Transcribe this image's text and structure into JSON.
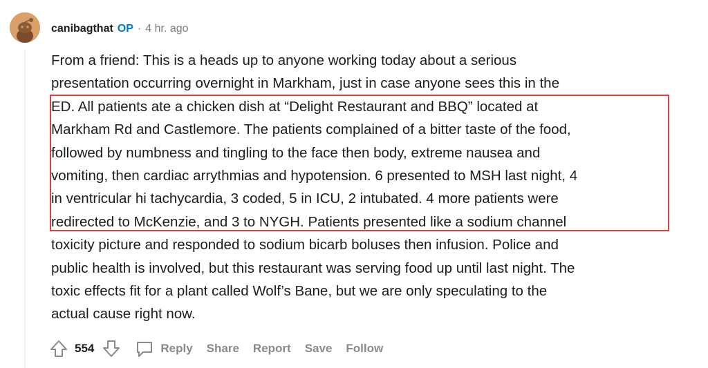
{
  "comment": {
    "username": "canibagthat",
    "op_badge": "OP",
    "separator": "·",
    "timestamp": "4 hr. ago",
    "avatar_icon": "snoo-avatar-icon",
    "body_lines": [
      "From a friend: This is a heads up to anyone working today about a serious",
      "presentation occurring overnight in Markham, just in case anyone sees this in the",
      "ED.  All patients ate a chicken dish at “Delight Restaurant and BBQ” located at",
      "Markham Rd and Castlemore.  The patients complained of a bitter taste of the food,",
      "followed by numbness and tingling to the face then body, extreme nausea and",
      "vomiting, then cardiac arrythmias and hypotension.  6 presented to MSH last night, 4",
      "in ventricular hi tachycardia, 3 coded, 5 in ICU, 2 intubated.  4 more patients were",
      "redirected to McKenzie, and 3 to NYGH.  Patients presented like a sodium channel",
      "toxicity picture and responded to sodium bicarb boluses then infusion.  Police and",
      "public health is involved, but this restaurant was serving food up until last night.  The",
      "toxic effects fit for a plant called Wolf’s Bane, but we are only speculating to the",
      "actual cause right now."
    ],
    "highlight_color": "#e33b3b"
  },
  "actions": {
    "vote_count": "554",
    "upvote_icon": "upvote-arrow-icon",
    "downvote_icon": "downvote-arrow-icon",
    "reply_icon": "comment-bubble-icon",
    "reply": "Reply",
    "share": "Share",
    "report": "Report",
    "save": "Save",
    "follow": "Follow"
  },
  "colors": {
    "op_badge": "#0079d3",
    "meta_text": "#7c7c7c",
    "action_text": "#878a8c",
    "body_text": "#1c1c1c"
  }
}
